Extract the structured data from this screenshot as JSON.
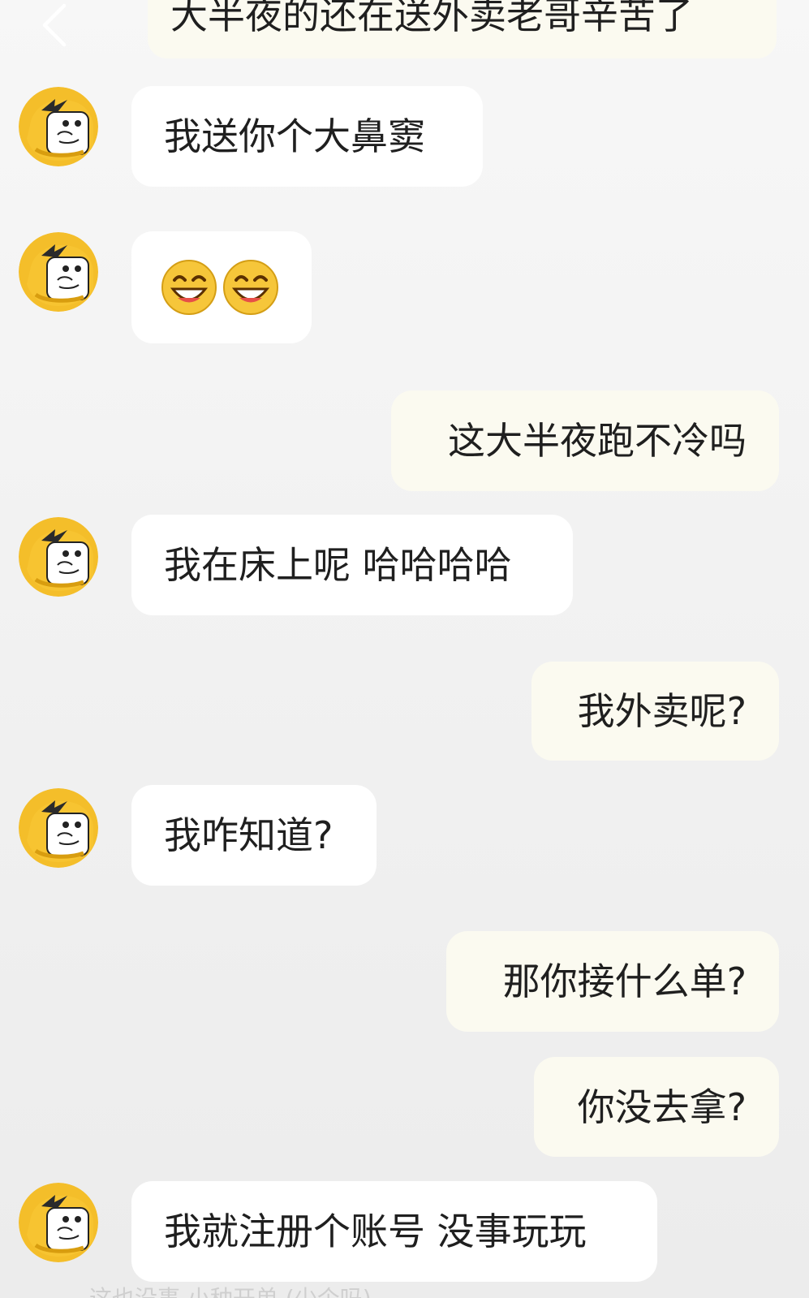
{
  "chat": {
    "back_icon": "chevron-left-icon",
    "top_message": "大半夜的还在送外卖老哥辛苦了",
    "messages": [
      {
        "side": "left",
        "text": "我送你个大鼻窦"
      },
      {
        "side": "left",
        "text": "",
        "emoji": [
          "grinning-face-icon",
          "grinning-face-icon"
        ]
      },
      {
        "side": "right",
        "text": "这大半夜跑不冷吗"
      },
      {
        "side": "left",
        "text": "我在床上呢 哈哈哈哈"
      },
      {
        "side": "right",
        "text": "我外卖呢?"
      },
      {
        "side": "left",
        "text": "我咋知道?"
      },
      {
        "side": "right",
        "text": "那你接什么单?"
      },
      {
        "side": "right",
        "text": "你没去拿?"
      },
      {
        "side": "left",
        "text": "我就注册个账号 没事玩玩"
      }
    ],
    "footer_text": "这也没事 小种开单 (少个吗)"
  },
  "colors": {
    "left_bubble": "#ffffff",
    "right_bubble": "#fbfaf0",
    "background": "#f1f1f1",
    "avatar_yellow": "#f4be2a"
  }
}
